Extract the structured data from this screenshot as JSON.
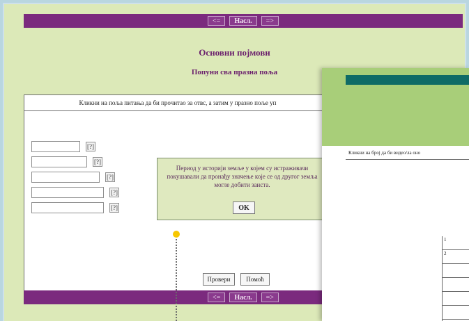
{
  "nav": {
    "prev": "<=",
    "home": "Насл.",
    "next": "=>"
  },
  "titles": {
    "main": "Основни појмови",
    "sub": "Попуни сва празна поља"
  },
  "instruction": "Кликни на поља питања да би прочитао за отвс, а затим у празно поље уп",
  "fields": [
    {
      "value": "",
      "help": "[?]"
    },
    {
      "value": "",
      "help": "[?]"
    },
    {
      "value": "",
      "help": "[?]"
    },
    {
      "value": "",
      "help": "[?]"
    },
    {
      "value": "",
      "help": "[?]"
    }
  ],
  "tooltip": {
    "text": "Период у историји земље у којем су истраживачи покушавали да пронађу значење које се од другог земља могле добити заиста.",
    "ok": "OK"
  },
  "buttons": {
    "check": "Провери",
    "help": "Помоћ"
  },
  "second_window": {
    "instruction": "Кликни на број да би видео/ла оно",
    "grid_labels": [
      "1",
      "2"
    ]
  },
  "colors": {
    "nav": "#7b2a7e",
    "background": "#dce9b8",
    "accent_green": "#a8ce79",
    "accent_teal": "#0e6b66",
    "marker": "#f7c700"
  }
}
